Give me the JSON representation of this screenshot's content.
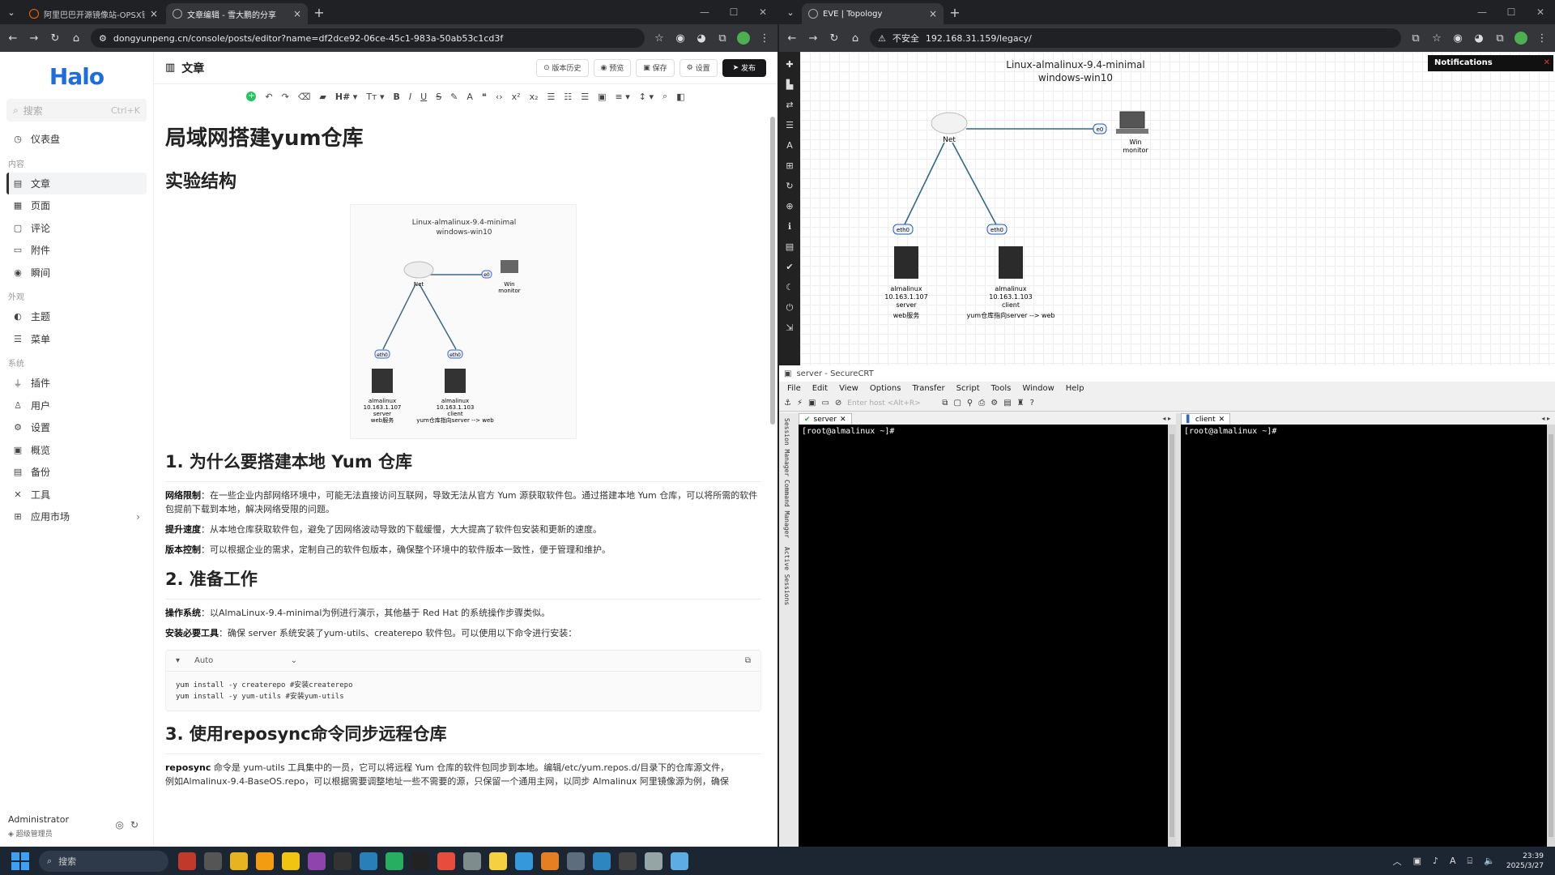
{
  "left_browser": {
    "tabs": [
      {
        "label": "阿里巴巴开源镜像站-OPSX镜..."
      },
      {
        "label": "文章编辑 - 雪大鹏的分享"
      }
    ],
    "url": "dongyunpeng.cn/console/posts/editor?name=df2dce92-06ce-45c1-983a-50ab53c1cd3f"
  },
  "halo": {
    "logo": "Halo",
    "search_placeholder": "搜索",
    "search_shortcut": "Ctrl+K",
    "dashboard": "仪表盘",
    "groups": {
      "content": "内容",
      "appearance": "外观",
      "system": "系统"
    },
    "content_items": [
      "文章",
      "页面",
      "评论",
      "附件",
      "瞬间"
    ],
    "appearance_items": [
      "主题",
      "菜单"
    ],
    "system_items": [
      "插件",
      "用户",
      "设置",
      "概览",
      "备份",
      "工具",
      "应用市场"
    ],
    "user": {
      "name": "Administrator",
      "role": "超级管理员"
    }
  },
  "editor": {
    "page_title": "文章",
    "buttons": {
      "history": "版本历史",
      "preview": "预览",
      "save": "保存",
      "settings": "设置",
      "publish": "发布"
    },
    "heading_tool": "H#",
    "title": "局域网搭建yum仓库",
    "section1": "实验结构",
    "section2": "1. 为什么要搭建本地 Yum 仓库",
    "reasons": [
      {
        "label": "网络限制",
        "text": "：在一些企业内部网络环境中，可能无法直接访问互联网，导致无法从官方 Yum 源获取软件包。通过搭建本地 Yum 仓库，可以将所需的软件包提前下载到本地，解决网络受限的问题。"
      },
      {
        "label": "提升速度",
        "text": "：从本地仓库获取软件包，避免了因网络波动导致的下载缓慢，大大提高了软件包安装和更新的速度。"
      },
      {
        "label": "版本控制",
        "text": "：可以根据企业的需求，定制自己的软件包版本，确保整个环境中的软件版本一致性，便于管理和维护。"
      }
    ],
    "section3": "2. 准备工作",
    "prep": [
      {
        "label": "操作系统",
        "text": "：以AlmaLinux-9.4-minimal为例进行演示，其他基于 Red Hat 的系统操作步骤类似。"
      },
      {
        "label": "安装必要工具",
        "text": "：确保 server 系统安装了yum-utils、createrepo 软件包。可以使用以下命令进行安装："
      }
    ],
    "code_lang": "Auto",
    "code_lines": [
      "yum install -y createrepo #安装createrepo",
      "yum install -y yum-utils #安装yum-utils"
    ],
    "section4": "3. 使用reposync命令同步远程仓库",
    "last_para_label": "reposync",
    "last_para": " 命令是 yum-utils 工具集中的一员，它可以将远程 Yum 仓库的软件包同步到本地。编辑/etc/yum.repos.d/目录下的仓库源文件，",
    "last_para2": "例如Almalinux-9.4-BaseOS.repo，可以根据需要调整地址一些不需要的源，只保留一个通用主网，以同步 Almalinux 阿里镜像源为例，确保"
  },
  "topology": {
    "title_line1": "Linux-almalinux-9.4-minimal",
    "title_line2": "windows-win10",
    "net_label": "Net",
    "win_label": "Win",
    "win_role": "monitor",
    "port_e0": "e0",
    "port_eth0": "eth0",
    "server": {
      "name": "almalinux",
      "ip": "10.163.1.107",
      "role": "server",
      "desc": "web服务"
    },
    "client": {
      "name": "almalinux",
      "ip": "10.163.1.103",
      "role": "client",
      "desc": "yum仓库指向server --> web"
    }
  },
  "eve_browser": {
    "tab": "EVE | Topology",
    "security": "不安全",
    "url": "192.168.31.159/legacy/",
    "notifications": "Notifications"
  },
  "securecrt": {
    "title": "server - SecureCRT",
    "menu": [
      "File",
      "Edit",
      "View",
      "Options",
      "Transfer",
      "Script",
      "Tools",
      "Window",
      "Help"
    ],
    "host_placeholder": "Enter host <Alt+R>",
    "side_tabs": [
      "Session Manager",
      "Command Manager",
      "Active Sessions"
    ],
    "panes": [
      {
        "tab": "server",
        "prompt": "[root@almalinux ~]#"
      },
      {
        "tab": "client",
        "prompt": "[root@almalinux ~]#"
      }
    ]
  },
  "taskbar": {
    "search": "搜索",
    "time": "23:39",
    "date": "2025/3/27"
  }
}
